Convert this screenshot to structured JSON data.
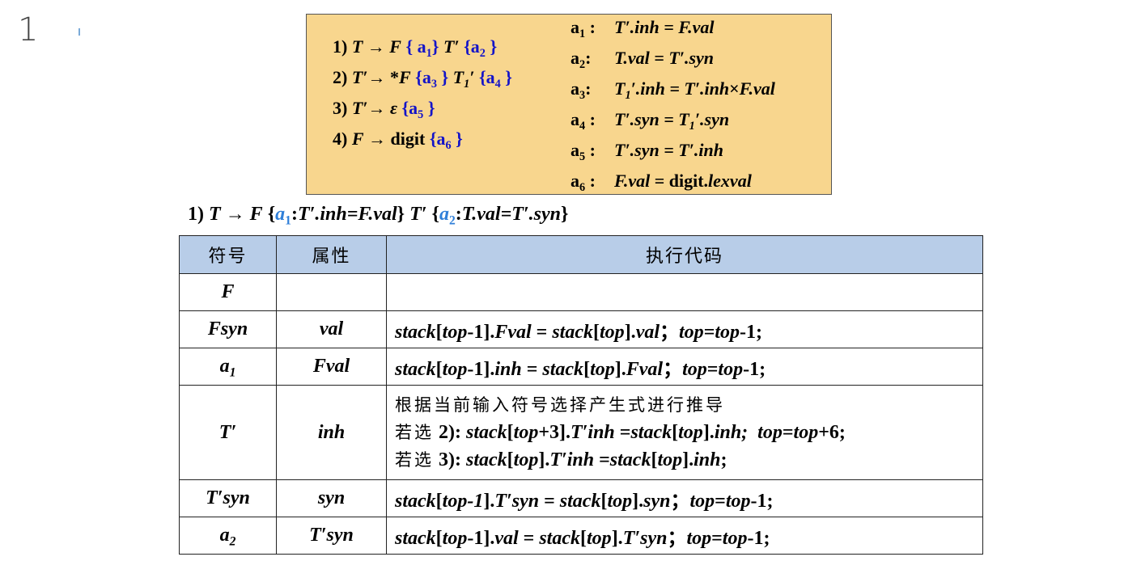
{
  "slide_number": "1",
  "grammar": {
    "productions": [
      {
        "num": "1)",
        "lhs": "T",
        "arrow": "→",
        "body": [
          [
            "F",
            "i"
          ],
          [
            " ",
            "n"
          ],
          [
            "{ a",
            "b"
          ],
          [
            "1",
            "bsub"
          ],
          [
            "}",
            "b"
          ],
          [
            " T′ ",
            "i"
          ],
          [
            "{a",
            "b"
          ],
          [
            "2",
            "bsub"
          ],
          [
            " }",
            "b"
          ]
        ]
      },
      {
        "num": "2)",
        "lhs": "T′",
        "arrow": "→",
        "body": [
          [
            " *F ",
            "i"
          ],
          [
            "{a",
            "b"
          ],
          [
            "3",
            "bsub"
          ],
          [
            " }",
            "b"
          ],
          [
            " T",
            "i"
          ],
          [
            "1",
            "isub"
          ],
          [
            "′ ",
            "i"
          ],
          [
            "{a",
            "b"
          ],
          [
            "4",
            "bsub"
          ],
          [
            " }",
            "b"
          ]
        ]
      },
      {
        "num": "3)",
        "lhs": "T′",
        "arrow": "→",
        "body": [
          [
            " ε ",
            "i"
          ],
          [
            "{a",
            "b"
          ],
          [
            "5",
            "bsub"
          ],
          [
            " }",
            "b"
          ]
        ]
      },
      {
        "num": "4)",
        "lhs": "F",
        "arrow": "→",
        "body": [
          [
            " digit ",
            "n"
          ],
          [
            "{a",
            "b"
          ],
          [
            "6",
            "bsub"
          ],
          [
            " }",
            "b"
          ]
        ]
      }
    ],
    "actions": [
      {
        "label": "a",
        "sub": "1",
        "text": "T′.inh = F.val"
      },
      {
        "label": "a",
        "sub": "2",
        "text": "T.val = T′.syn"
      },
      {
        "label": "a",
        "sub": "3",
        "text": "T1′.inh = T′.inh×F.val"
      },
      {
        "label": "a",
        "sub": "4",
        "text": "T′.syn = T1′.syn"
      },
      {
        "label": "a",
        "sub": "5",
        "text": "T′.syn = T′.inh"
      },
      {
        "label": "a",
        "sub": "6",
        "text": "F.val = digit.lexval"
      }
    ]
  },
  "subtitle": "1) T → F {a1:T′.inh=F.val} T′ {a2:T.val=T′.syn}",
  "table": {
    "headers": [
      "符号",
      "属性",
      "执行代码"
    ],
    "rows": [
      {
        "symbol": "F",
        "attr": "",
        "code": ""
      },
      {
        "symbol": "Fsyn",
        "attr": "val",
        "code": "stack[top-1].Fval = stack[top].val；top=top-1;"
      },
      {
        "symbol": "a1",
        "attr": "Fval",
        "code": "stack[top-1].inh = stack[top].Fval；top=top-1;"
      },
      {
        "symbol": "T′",
        "attr": "inh",
        "code_lines": [
          "根据当前输入符号选择产生式进行推导",
          "若选 2): stack[top+3].T′inh =stack[top].inh; top=top+6;",
          "若选 3): stack[top].T′inh =stack[top].inh;"
        ]
      },
      {
        "symbol": "T′syn",
        "attr": "syn",
        "code": "stack[top-1].T′syn = stack[top].syn；top=top-1;"
      },
      {
        "symbol": "a2",
        "attr": "T′syn",
        "code": "stack[top-1].val = stack[top].T′syn；top=top-1;"
      }
    ]
  }
}
